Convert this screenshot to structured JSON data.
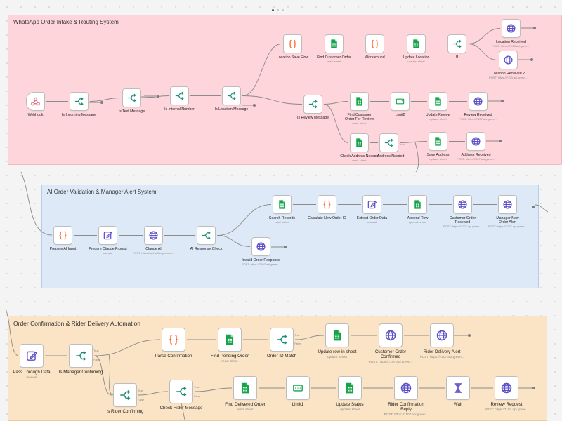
{
  "canvas": {
    "pager": [
      "active",
      "",
      ""
    ],
    "colors": {
      "pink_bg": "#fdd5db",
      "pink_border": "#f3b7c2",
      "blue_bg": "#dde9f7",
      "blue_border": "#b5cde8",
      "orange_bg": "#fbe4c6",
      "orange_border": "#f1c995",
      "orange_icon": "#ff6d3b",
      "green_icon": "#14a34a",
      "purple_icon": "#5a4fc8",
      "teal_icon": "#1d8c78",
      "webhook_icon": "#e05d6f",
      "edge": "#8b8b8b"
    }
  },
  "stickies": [
    {
      "id": "s1",
      "title": "WhatsApp Order Intake & Routing System",
      "color": "pink"
    },
    {
      "id": "s2",
      "title": "AI Order Validation & Manager Alert System",
      "color": "blue"
    },
    {
      "id": "s3",
      "title": "Order Confirmation & Rider Delivery Automation",
      "color": "orange"
    }
  ],
  "nodes": [
    {
      "id": "webhook",
      "label": "Webhook",
      "sub": "",
      "icon": "webhook-icon"
    },
    {
      "id": "is_incoming",
      "label": "Is Incoming Message",
      "sub": "",
      "icon": "switch-icon"
    },
    {
      "id": "is_text",
      "label": "Is Text Message",
      "sub": "",
      "icon": "switch-icon"
    },
    {
      "id": "is_internal",
      "label": "Is Internal Number",
      "sub": "",
      "icon": "switch-icon"
    },
    {
      "id": "is_location",
      "label": "Is Location Message",
      "sub": "",
      "icon": "switch-icon"
    },
    {
      "id": "location_save_flow",
      "label": "Location Save Flow",
      "sub": "",
      "icon": "code-icon"
    },
    {
      "id": "find_customer_order",
      "label": "Find Customer Order",
      "sub": "read: sheet",
      "icon": "sheets-icon"
    },
    {
      "id": "workaround",
      "label": "Workaround",
      "sub": "",
      "icon": "code-icon"
    },
    {
      "id": "update_location",
      "label": "Update Location",
      "sub": "update: sheet",
      "icon": "sheets-icon"
    },
    {
      "id": "if1",
      "label": "If",
      "sub": "",
      "icon": "switch-icon"
    },
    {
      "id": "location_received",
      "label": "Location Received",
      "sub": "POST: https://7b03.api.green...",
      "icon": "globe-icon"
    },
    {
      "id": "location_received_2",
      "label": "Location Received 2",
      "sub": "POST: https://7103.api.green...",
      "icon": "globe-icon"
    },
    {
      "id": "is_review",
      "label": "Is Review Message",
      "sub": "",
      "icon": "switch-icon"
    },
    {
      "id": "find_customer_order_review",
      "label": "Find Customer Order For Review",
      "sub": "read: sheet",
      "icon": "sheets-icon"
    },
    {
      "id": "limit2",
      "label": "Limit2",
      "sub": "",
      "icon": "limit-icon"
    },
    {
      "id": "update_review",
      "label": "Update Review",
      "sub": "update: sheet",
      "icon": "sheets-icon"
    },
    {
      "id": "review_received",
      "label": "Review Received",
      "sub": "POST: https://7107.api.green...",
      "icon": "globe-icon"
    },
    {
      "id": "check_address",
      "label": "Check Address Needed",
      "sub": "read: sheet",
      "icon": "sheets-icon"
    },
    {
      "id": "is_address_needed",
      "label": "Is Address Needed",
      "sub": "",
      "icon": "switch-icon"
    },
    {
      "id": "save_address",
      "label": "Save Address",
      "sub": "update: sheet",
      "icon": "sheets-icon"
    },
    {
      "id": "address_received",
      "label": "Address Received",
      "sub": "POST: https://7107.api.green...",
      "icon": "globe-icon"
    },
    {
      "id": "prepare_ai_input",
      "label": "Prepare AI Input",
      "sub": "",
      "icon": "code-icon"
    },
    {
      "id": "prepare_claude_prompt",
      "label": "Prepare Claude Prompt",
      "sub": "manual",
      "icon": "edit-icon"
    },
    {
      "id": "claude_ai",
      "label": "Claude AI",
      "sub": "POST: https://api.anthropic.com...",
      "icon": "globe-icon"
    },
    {
      "id": "ai_response_check",
      "label": "AI Response Check",
      "sub": "",
      "icon": "switch-icon"
    },
    {
      "id": "search_records",
      "label": "Search Records",
      "sub": "read: sheet",
      "icon": "sheets-icon"
    },
    {
      "id": "calc_order_id",
      "label": "Calculate New Order ID",
      "sub": "",
      "icon": "code-icon"
    },
    {
      "id": "extract_order",
      "label": "Extract Order Data",
      "sub": "manual",
      "icon": "edit-icon"
    },
    {
      "id": "append_row",
      "label": "Append Row",
      "sub": "append: sheet",
      "icon": "sheets-icon"
    },
    {
      "id": "customer_order_received",
      "label": "Customer Order Received",
      "sub": "POST: https://7107.api.green...",
      "icon": "globe-icon"
    },
    {
      "id": "manager_new_order",
      "label": "Manager New Order Alert",
      "sub": "POST: https://7107.api.green...",
      "icon": "globe-icon"
    },
    {
      "id": "invalid_order",
      "label": "Invalid Order Response",
      "sub": "POST: https://7107.api.green...",
      "icon": "globe-icon"
    },
    {
      "id": "pass_through",
      "label": "Pass Through Data",
      "sub": "manual",
      "icon": "edit-icon"
    },
    {
      "id": "is_manager_confirming",
      "label": "Is Manager Confirming",
      "sub": "",
      "icon": "switch-icon"
    },
    {
      "id": "parse_confirmation",
      "label": "Parse Confirmation",
      "sub": "",
      "icon": "code-icon"
    },
    {
      "id": "find_pending_order",
      "label": "Find Pending Order",
      "sub": "read: sheet",
      "icon": "sheets-icon"
    },
    {
      "id": "order_id_match",
      "label": "Order ID Match",
      "sub": "",
      "icon": "switch-icon"
    },
    {
      "id": "update_row_sheet",
      "label": "Update row in sheet",
      "sub": "update: sheet",
      "icon": "sheets-icon"
    },
    {
      "id": "customer_order_confirmed",
      "label": "Customer Order Confirmed",
      "sub": "POST: https://7107.api.green...",
      "icon": "globe-icon"
    },
    {
      "id": "rider_delivery_alert",
      "label": "Rider Delivery Alert",
      "sub": "POST: https://7107.api.green...",
      "icon": "globe-icon"
    },
    {
      "id": "is_rider_confirming",
      "label": "Is Rider Confirming",
      "sub": "",
      "icon": "switch-icon"
    },
    {
      "id": "check_rider_message",
      "label": "Check Rider Message",
      "sub": "",
      "icon": "switch-icon"
    },
    {
      "id": "find_delivered_order",
      "label": "Find Delivered Order",
      "sub": "read: sheet",
      "icon": "sheets-icon"
    },
    {
      "id": "limit1",
      "label": "Limit1",
      "sub": "",
      "icon": "limit-icon"
    },
    {
      "id": "update_status",
      "label": "Update Status",
      "sub": "update: sheet",
      "icon": "sheets-icon"
    },
    {
      "id": "rider_confirmation_reply",
      "label": "Rider Confirmation Reply",
      "sub": "POST: https://7107.api.green...",
      "icon": "globe-icon"
    },
    {
      "id": "wait",
      "label": "Wait",
      "sub": "",
      "icon": "hourglass-icon"
    },
    {
      "id": "review_request",
      "label": "Review Request",
      "sub": "POST: https://7107.api.green...",
      "icon": "globe-icon"
    }
  ],
  "port_labels": {
    "true": "True",
    "false": "False"
  }
}
